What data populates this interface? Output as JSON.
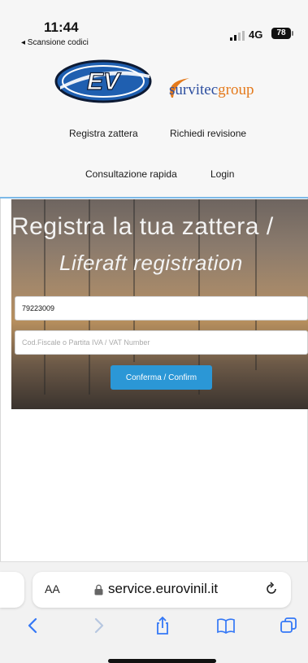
{
  "status_bar": {
    "time": "11:44",
    "back_app": "◂ Scansione codici",
    "network": "4G",
    "battery": "78"
  },
  "header": {
    "ev_logo_text": "EV",
    "brand_part1": "survitec",
    "brand_part2": "group",
    "nav": {
      "register_raft": "Registra zattera",
      "request_revision": "Richiedi revisione",
      "quick_lookup": "Consultazione rapida",
      "login": "Login"
    }
  },
  "hero": {
    "title": "Registra la tua zattera /",
    "subtitle": "Liferaft registration",
    "serial_value": "79223009",
    "vat_placeholder": "Cod.Fiscale o Partita IVA / VAT Number",
    "confirm_label": "Conferma / Confirm"
  },
  "browser": {
    "text_size_label": "AA",
    "url": "service.eurovinil.it"
  },
  "colors": {
    "accent_blue": "#2b97d6",
    "ev_blue": "#1f5fb0",
    "survitec_blue": "#2d4fa0",
    "survitec_orange": "#e47a1c",
    "ios_blue": "#3478f6"
  }
}
